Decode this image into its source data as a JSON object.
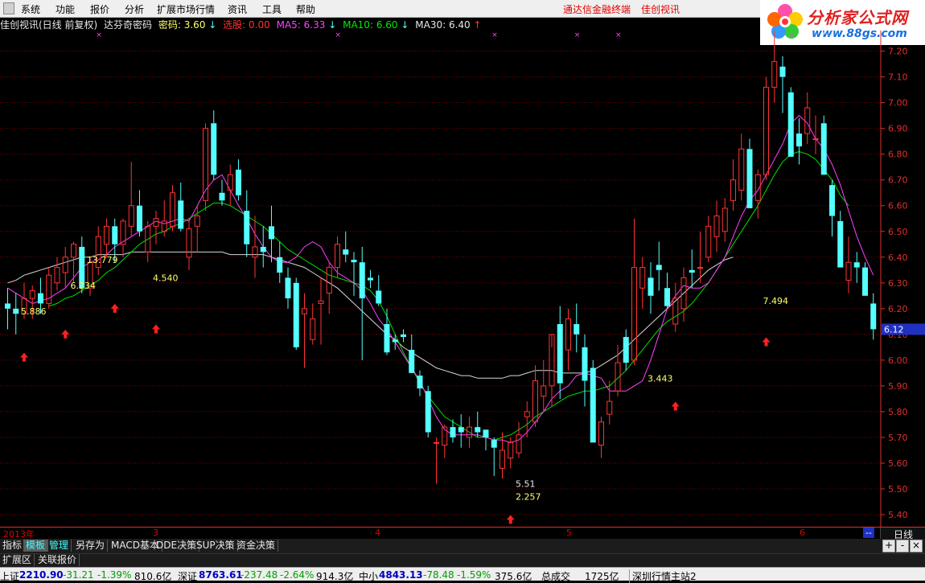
{
  "menu": {
    "items": [
      "系统",
      "功能",
      "报价",
      "分析",
      "扩展市场行情",
      "资讯",
      "工具",
      "帮助"
    ],
    "right_links": [
      "通达信金融终端",
      "佳创视讯"
    ]
  },
  "logo": {
    "name": "分析家公式网",
    "url": "www.88gs.com"
  },
  "info": {
    "title": "佳创视讯(日线 前复权)",
    "indicator": "达芬奇密码",
    "mima_label": "密码:",
    "mima_value": "3.60",
    "xuangu_label": "选股:",
    "xuangu_value": "0.00",
    "ma5_label": "MA5:",
    "ma5_value": "6.33",
    "ma10_label": "MA10:",
    "ma10_value": "6.60",
    "ma30_label": "MA30:",
    "ma30_value": "6.40"
  },
  "colors": {
    "up": "#ff3333",
    "down": "#54ffff",
    "ma5": "#ff40ff",
    "ma10": "#00dd00",
    "ma30": "#d8d8d8",
    "grid": "#7a0000",
    "axis_text": "#e03030",
    "label": "#ffff66",
    "arrow": "#ff2020"
  },
  "chart_data": {
    "type": "candlestick",
    "ylim": [
      5.35,
      7.28
    ],
    "y_ticks": [
      "7.20",
      "7.10",
      "7.00",
      "6.90",
      "6.80",
      "6.70",
      "6.60",
      "6.50",
      "6.40",
      "6.30",
      "6.20",
      "6.10",
      "6.00",
      "5.90",
      "5.80",
      "5.70",
      "5.60",
      "5.50",
      "5.40"
    ],
    "current_price": "6.12",
    "x_labels": [
      "2013年",
      "3",
      "4",
      "5",
      "6"
    ],
    "candles": [
      [
        6.22,
        6.28,
        6.12,
        6.2
      ],
      [
        6.2,
        6.26,
        6.1,
        6.18
      ],
      [
        6.18,
        6.3,
        6.16,
        6.24
      ],
      [
        6.24,
        6.29,
        6.16,
        6.27
      ],
      [
        6.26,
        6.32,
        6.18,
        6.22
      ],
      [
        6.22,
        6.36,
        6.2,
        6.33
      ],
      [
        6.3,
        6.4,
        6.27,
        6.36
      ],
      [
        6.34,
        6.44,
        6.28,
        6.4
      ],
      [
        6.4,
        6.46,
        6.3,
        6.45
      ],
      [
        6.44,
        6.48,
        6.26,
        6.28
      ],
      [
        6.28,
        6.4,
        6.25,
        6.38
      ],
      [
        6.36,
        6.52,
        6.33,
        6.48
      ],
      [
        6.45,
        6.55,
        6.4,
        6.52
      ],
      [
        6.52,
        6.55,
        6.38,
        6.45
      ],
      [
        6.45,
        6.55,
        6.4,
        6.54
      ],
      [
        6.52,
        6.77,
        6.48,
        6.6
      ],
      [
        6.6,
        6.66,
        6.48,
        6.5
      ],
      [
        6.42,
        6.54,
        6.38,
        6.52
      ],
      [
        6.52,
        6.58,
        6.45,
        6.55
      ],
      [
        6.5,
        6.62,
        6.48,
        6.54
      ],
      [
        6.52,
        6.68,
        6.5,
        6.65
      ],
      [
        6.62,
        6.69,
        6.5,
        6.51
      ],
      [
        6.4,
        6.55,
        6.35,
        6.51
      ],
      [
        6.52,
        6.6,
        6.42,
        6.56
      ],
      [
        6.62,
        6.92,
        6.58,
        6.9
      ],
      [
        6.92,
        6.97,
        6.7,
        6.72
      ],
      [
        6.65,
        6.7,
        6.6,
        6.62
      ],
      [
        6.66,
        6.76,
        6.6,
        6.72
      ],
      [
        6.74,
        6.78,
        6.62,
        6.64
      ],
      [
        6.58,
        6.66,
        6.4,
        6.45
      ],
      [
        6.4,
        6.56,
        6.32,
        6.44
      ],
      [
        6.44,
        6.52,
        6.36,
        6.42
      ],
      [
        6.52,
        6.6,
        6.38,
        6.47
      ],
      [
        6.4,
        6.46,
        6.3,
        6.34
      ],
      [
        6.32,
        6.36,
        6.2,
        6.24
      ],
      [
        6.3,
        6.32,
        6.04,
        6.05
      ],
      [
        6.18,
        6.26,
        5.97,
        6.2
      ],
      [
        6.08,
        6.22,
        6.06,
        6.16
      ],
      [
        6.22,
        6.32,
        6.06,
        6.23
      ],
      [
        6.26,
        6.38,
        6.18,
        6.36
      ],
      [
        6.36,
        6.48,
        6.32,
        6.45
      ],
      [
        6.43,
        6.5,
        6.38,
        6.41
      ],
      [
        6.39,
        6.42,
        6.25,
        6.38
      ],
      [
        6.38,
        6.44,
        6.0,
        6.24
      ],
      [
        6.32,
        6.35,
        6.28,
        6.31
      ],
      [
        6.27,
        6.33,
        6.21,
        6.22
      ],
      [
        6.14,
        6.2,
        6.02,
        6.03
      ],
      [
        6.08,
        6.1,
        6.04,
        6.07
      ],
      [
        6.1,
        6.12,
        6.07,
        6.09
      ],
      [
        6.04,
        6.1,
        5.95,
        5.95
      ],
      [
        5.94,
        5.96,
        5.86,
        5.89
      ],
      [
        5.88,
        5.9,
        5.7,
        5.72
      ],
      [
        5.68,
        5.7,
        5.52,
        5.68
      ],
      [
        5.67,
        5.75,
        5.62,
        5.74
      ],
      [
        5.74,
        5.77,
        5.68,
        5.7
      ],
      [
        5.74,
        5.79,
        5.66,
        5.72
      ],
      [
        5.7,
        5.78,
        5.66,
        5.74
      ],
      [
        5.74,
        5.8,
        5.7,
        5.72
      ],
      [
        5.73,
        5.73,
        5.65,
        5.7
      ],
      [
        5.69,
        5.7,
        5.55,
        5.66
      ],
      [
        5.58,
        5.72,
        5.54,
        5.65
      ],
      [
        5.62,
        5.7,
        5.58,
        5.68
      ],
      [
        5.64,
        5.76,
        5.62,
        5.71
      ],
      [
        5.78,
        5.84,
        5.7,
        5.8
      ],
      [
        5.76,
        5.98,
        5.74,
        5.92
      ],
      [
        5.86,
        6.0,
        5.8,
        5.9
      ],
      [
        5.9,
        6.05,
        5.82,
        6.1
      ],
      [
        6.14,
        6.21,
        5.85,
        5.91
      ],
      [
        6.04,
        6.2,
        5.96,
        6.16
      ],
      [
        6.14,
        6.22,
        6.03,
        6.1
      ],
      [
        6.05,
        6.1,
        5.82,
        5.92
      ],
      [
        5.97,
        6.0,
        5.68,
        5.68
      ],
      [
        5.67,
        5.78,
        5.62,
        5.76
      ],
      [
        5.79,
        5.92,
        5.75,
        5.84
      ],
      [
        5.88,
        6.06,
        5.86,
        5.99
      ],
      [
        6.09,
        6.12,
        5.96,
        5.99
      ],
      [
        6.0,
        6.55,
        5.98,
        6.36
      ],
      [
        6.28,
        6.4,
        6.2,
        6.36
      ],
      [
        6.32,
        6.38,
        6.18,
        6.25
      ],
      [
        6.37,
        6.46,
        6.27,
        6.35
      ],
      [
        6.28,
        6.34,
        6.2,
        6.21
      ],
      [
        6.14,
        6.3,
        6.11,
        6.24
      ],
      [
        6.2,
        6.36,
        6.15,
        6.32
      ],
      [
        6.35,
        6.43,
        6.28,
        6.34
      ],
      [
        6.36,
        6.5,
        6.3,
        6.36
      ],
      [
        6.4,
        6.56,
        6.38,
        6.52
      ],
      [
        6.48,
        6.62,
        6.42,
        6.56
      ],
      [
        6.5,
        6.63,
        6.46,
        6.59
      ],
      [
        6.62,
        6.78,
        6.58,
        6.7
      ],
      [
        6.66,
        6.88,
        6.62,
        6.82
      ],
      [
        6.82,
        6.86,
        6.6,
        6.59
      ],
      [
        6.62,
        6.74,
        6.55,
        6.72
      ],
      [
        6.72,
        7.1,
        6.7,
        7.06
      ],
      [
        7.06,
        7.29,
        7.0,
        7.16
      ],
      [
        7.14,
        7.18,
        6.96,
        7.1
      ],
      [
        7.04,
        7.06,
        6.8,
        6.79
      ],
      [
        6.88,
        6.94,
        6.76,
        6.83
      ],
      [
        6.88,
        7.04,
        6.84,
        6.98
      ],
      [
        6.86,
        6.95,
        6.8,
        6.86
      ],
      [
        6.92,
        6.95,
        6.72,
        6.72
      ],
      [
        6.68,
        6.7,
        6.48,
        6.56
      ],
      [
        6.54,
        6.58,
        6.36,
        6.36
      ],
      [
        6.31,
        6.48,
        6.26,
        6.38
      ],
      [
        6.38,
        6.42,
        6.3,
        6.36
      ],
      [
        6.36,
        6.38,
        6.25,
        6.25
      ],
      [
        6.22,
        6.26,
        6.08,
        6.12
      ]
    ],
    "ma5": [
      6.28,
      6.26,
      6.24,
      6.22,
      6.23,
      6.24,
      6.26,
      6.28,
      6.32,
      6.36,
      6.38,
      6.39,
      6.41,
      6.44,
      6.46,
      6.48,
      6.5,
      6.52,
      6.54,
      6.53,
      6.54,
      6.55,
      6.54,
      6.6,
      6.66,
      6.7,
      6.72,
      6.66,
      6.6,
      6.55,
      6.49,
      6.44,
      6.4,
      6.38,
      6.38,
      6.4,
      6.44,
      6.46,
      6.44,
      6.38,
      6.34,
      6.32,
      6.3,
      6.27,
      6.22,
      6.16,
      6.12,
      6.07,
      6.02,
      5.97,
      5.92,
      5.85,
      5.78,
      5.73,
      5.71,
      5.71,
      5.71,
      5.71,
      5.7,
      5.69,
      5.69,
      5.68,
      5.69,
      5.72,
      5.76,
      5.8,
      5.85,
      5.88,
      5.9,
      5.94,
      5.95,
      5.94,
      5.93,
      5.88,
      5.88,
      5.88,
      5.9,
      5.92,
      6.0,
      6.1,
      6.2,
      6.25,
      6.29,
      6.28,
      6.28,
      6.3,
      6.35,
      6.4,
      6.48,
      6.56,
      6.62,
      6.66,
      6.72,
      6.78,
      6.84,
      6.92,
      6.95,
      6.92,
      6.86,
      6.82,
      6.76,
      6.68,
      6.58,
      6.48,
      6.4,
      6.33
    ],
    "ma10": [
      null,
      null,
      null,
      null,
      null,
      6.21,
      6.22,
      6.24,
      6.25,
      6.27,
      6.29,
      6.31,
      6.34,
      6.36,
      6.39,
      6.42,
      6.45,
      6.47,
      6.49,
      6.5,
      6.52,
      6.53,
      6.55,
      6.57,
      6.59,
      6.61,
      6.61,
      6.6,
      6.58,
      6.56,
      6.54,
      6.52,
      6.49,
      6.46,
      6.43,
      6.41,
      6.39,
      6.37,
      6.35,
      6.33,
      6.32,
      6.31,
      6.3,
      6.29,
      6.27,
      6.23,
      6.17,
      6.1,
      6.03,
      5.97,
      5.91,
      5.86,
      5.82,
      5.78,
      5.76,
      5.74,
      5.72,
      5.7,
      5.7,
      5.69,
      5.7,
      5.71,
      5.73,
      5.75,
      5.78,
      5.8,
      5.82,
      5.84,
      5.86,
      5.87,
      5.88,
      5.88,
      5.89,
      5.9,
      5.93,
      5.96,
      6.0,
      6.04,
      6.08,
      6.12,
      6.15,
      6.17,
      6.19,
      6.22,
      6.26,
      6.3,
      6.35,
      6.4,
      6.45,
      6.5,
      6.55,
      6.6,
      6.66,
      6.72,
      6.77,
      6.8,
      6.81,
      6.8,
      6.78,
      6.74,
      6.7,
      6.64,
      6.6
    ],
    "ma30": [
      6.3,
      6.31,
      6.33,
      6.34,
      6.35,
      6.36,
      6.37,
      6.38,
      6.39,
      6.4,
      6.4,
      6.41,
      6.41,
      6.41,
      6.41,
      6.42,
      6.42,
      6.42,
      6.42,
      6.42,
      6.42,
      6.42,
      6.42,
      6.42,
      6.42,
      6.42,
      6.42,
      6.41,
      6.41,
      6.41,
      6.41,
      6.41,
      6.4,
      6.39,
      6.38,
      6.37,
      6.36,
      6.34,
      6.32,
      6.3,
      6.28,
      6.25,
      6.22,
      6.19,
      6.16,
      6.13,
      6.1,
      6.08,
      6.05,
      6.03,
      6.01,
      5.99,
      5.97,
      5.96,
      5.95,
      5.94,
      5.94,
      5.93,
      5.93,
      5.93,
      5.93,
      5.94,
      5.94,
      5.95,
      5.96,
      5.96,
      5.96,
      5.95,
      5.95,
      5.95,
      5.95,
      5.96,
      5.98,
      6.0,
      6.02,
      6.05,
      6.08,
      6.11,
      6.14,
      6.17,
      6.2,
      6.23,
      6.26,
      6.29,
      6.32,
      6.35,
      6.37,
      6.39,
      6.4
    ],
    "labels": [
      {
        "i": 2,
        "price": 6.19,
        "text": "5.886"
      },
      {
        "i": 8,
        "price": 6.29,
        "text": "6.234"
      },
      {
        "i": 10,
        "price": 6.39,
        "text": "13.779"
      },
      {
        "i": 18,
        "price": 6.32,
        "text": "4.540"
      },
      {
        "i": 62,
        "price": 5.52,
        "text": "5.51"
      },
      {
        "i": 62,
        "price": 5.47,
        "text": "2.257"
      },
      {
        "i": 78,
        "price": 5.93,
        "text": "3.443"
      },
      {
        "i": 92,
        "price": 6.23,
        "text": "7.494"
      },
      {
        "i": 99,
        "price": 7.27,
        "text": "7.2"
      }
    ],
    "arrows": [
      {
        "i": 2,
        "price": 6.01
      },
      {
        "i": 7,
        "price": 6.1
      },
      {
        "i": 13,
        "price": 6.2
      },
      {
        "i": 18,
        "price": 6.12
      },
      {
        "i": 61,
        "price": 5.38
      },
      {
        "i": 81,
        "price": 5.82
      },
      {
        "i": 92,
        "price": 6.07
      }
    ],
    "star_marks": [
      11,
      40,
      59,
      69,
      74,
      95
    ]
  },
  "datebar": {
    "labels": [
      "2013年",
      "3",
      "4",
      "5",
      "6"
    ],
    "right_marker": "--",
    "period": "日线"
  },
  "tabs": [
    "指标",
    "模板",
    "管理",
    "另存为",
    "MACD基本",
    "DDE决策",
    "SUP决策",
    "资金决策"
  ],
  "tab_buttons": [
    "+",
    "-",
    "×"
  ],
  "ext_tabs": [
    "扩展区",
    "关联报价"
  ],
  "status": {
    "sh": {
      "label": "上证",
      "price": "2210.90",
      "chg": "-31.21",
      "pct": "-1.39%",
      "vol": "810.6亿"
    },
    "sz": {
      "label": "深证",
      "price": "8763.61",
      "chg": "-237.48",
      "pct": "-2.64%",
      "vol": "914.3亿"
    },
    "zx": {
      "label": "中小",
      "price": "4843.13",
      "chg": "-78.48",
      "pct": "-1.59%",
      "vol": "375.6亿"
    },
    "total_label": "总成交",
    "total_value": "1725亿",
    "station": "深圳行情主站2"
  }
}
